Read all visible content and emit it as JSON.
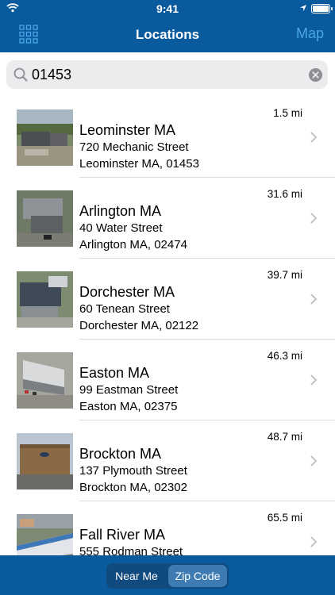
{
  "status_bar": {
    "time": "9:41"
  },
  "nav": {
    "title": "Locations",
    "map_label": "Map"
  },
  "search": {
    "value": "01453"
  },
  "locations": [
    {
      "name": "Leominster MA",
      "street": "720 Mechanic Street",
      "city": "Leominster MA, 01453",
      "distance": "1.5 mi"
    },
    {
      "name": "Arlington MA",
      "street": "40 Water Street",
      "city": "Arlington MA, 02474",
      "distance": "31.6 mi"
    },
    {
      "name": "Dorchester MA",
      "street": "60 Tenean Street",
      "city": "Dorchester MA, 02122",
      "distance": "39.7 mi"
    },
    {
      "name": "Easton MA",
      "street": "99 Eastman Street",
      "city": "Easton MA, 02375",
      "distance": "46.3 mi"
    },
    {
      "name": "Brockton MA",
      "street": "137 Plymouth Street",
      "city": "Brockton MA, 02302",
      "distance": "48.7 mi"
    },
    {
      "name": "Fall River MA",
      "street": "555 Rodman Street",
      "city": "",
      "distance": "65.5 mi"
    }
  ],
  "segmented": {
    "near_me": "Near Me",
    "zip_code": "Zip Code",
    "selected": "zip_code"
  },
  "colors": {
    "bar": "#0a5a9e",
    "accent": "#4aa6e6",
    "segment_selected": "#3f7bb3"
  }
}
